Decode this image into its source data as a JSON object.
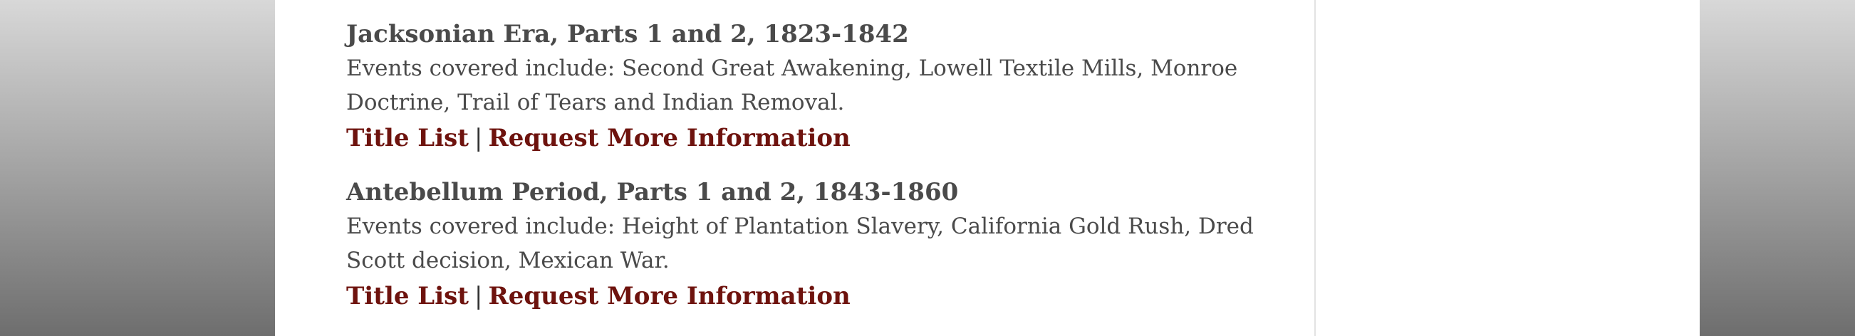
{
  "entries": [
    {
      "title": "Jacksonian Era, Parts 1 and 2, 1823-1842",
      "description": "Events covered include: Second Great Awakening, Lowell Textile Mills, Monroe Doctrine, Trail of Tears and Indian Removal.",
      "title_list_label": "Title List",
      "separator": "|",
      "request_info_label": "Request More Information"
    },
    {
      "title": "Antebellum Period, Parts 1 and 2, 1843-1860",
      "description": "Events covered include: Height of Plantation Slavery, California Gold Rush, Dred Scott decision, Mexican War.",
      "title_list_label": "Title List",
      "separator": "|",
      "request_info_label": "Request More Information"
    }
  ],
  "colors": {
    "link": "#6e130e",
    "text": "#4a4a4a"
  }
}
